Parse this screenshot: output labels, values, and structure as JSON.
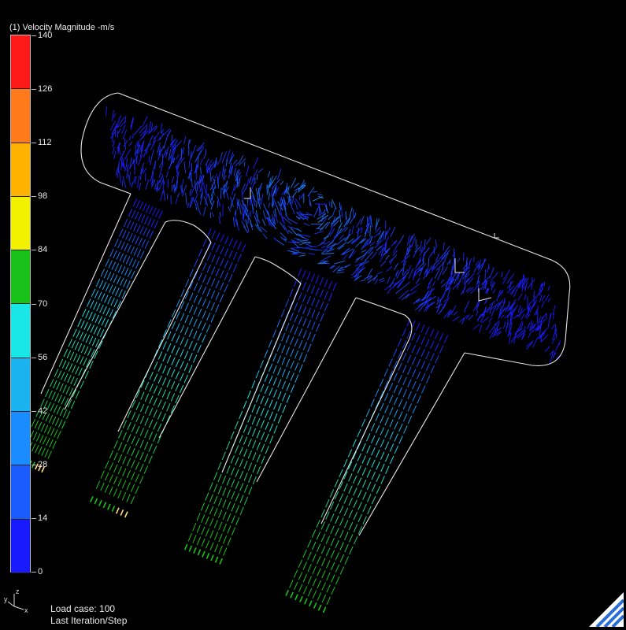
{
  "legend": {
    "title": "(1) Velocity Magnitude -m/s",
    "ticks": [
      "140",
      "126",
      "112",
      "98",
      "84",
      "70",
      "56",
      "42",
      "28",
      "14",
      "0"
    ],
    "segment_colors": [
      "#ff1a1a",
      "#ff7a1a",
      "#ffb300",
      "#f2f200",
      "#19c219",
      "#19e6e6",
      "#1ab3f0",
      "#1a8cff",
      "#1a5cff",
      "#1a1aff"
    ]
  },
  "status": {
    "load_case": "Load case: 100",
    "iteration": "Last Iteration/Step"
  },
  "triad": {
    "y": "y",
    "z": "z",
    "x": "x"
  },
  "colors": {
    "background": "#000000",
    "outline": "#e8e8e8",
    "low": "#1a1aff",
    "mid": "#19e6e6",
    "high": "#19c219",
    "peak": "#ffe080"
  }
}
